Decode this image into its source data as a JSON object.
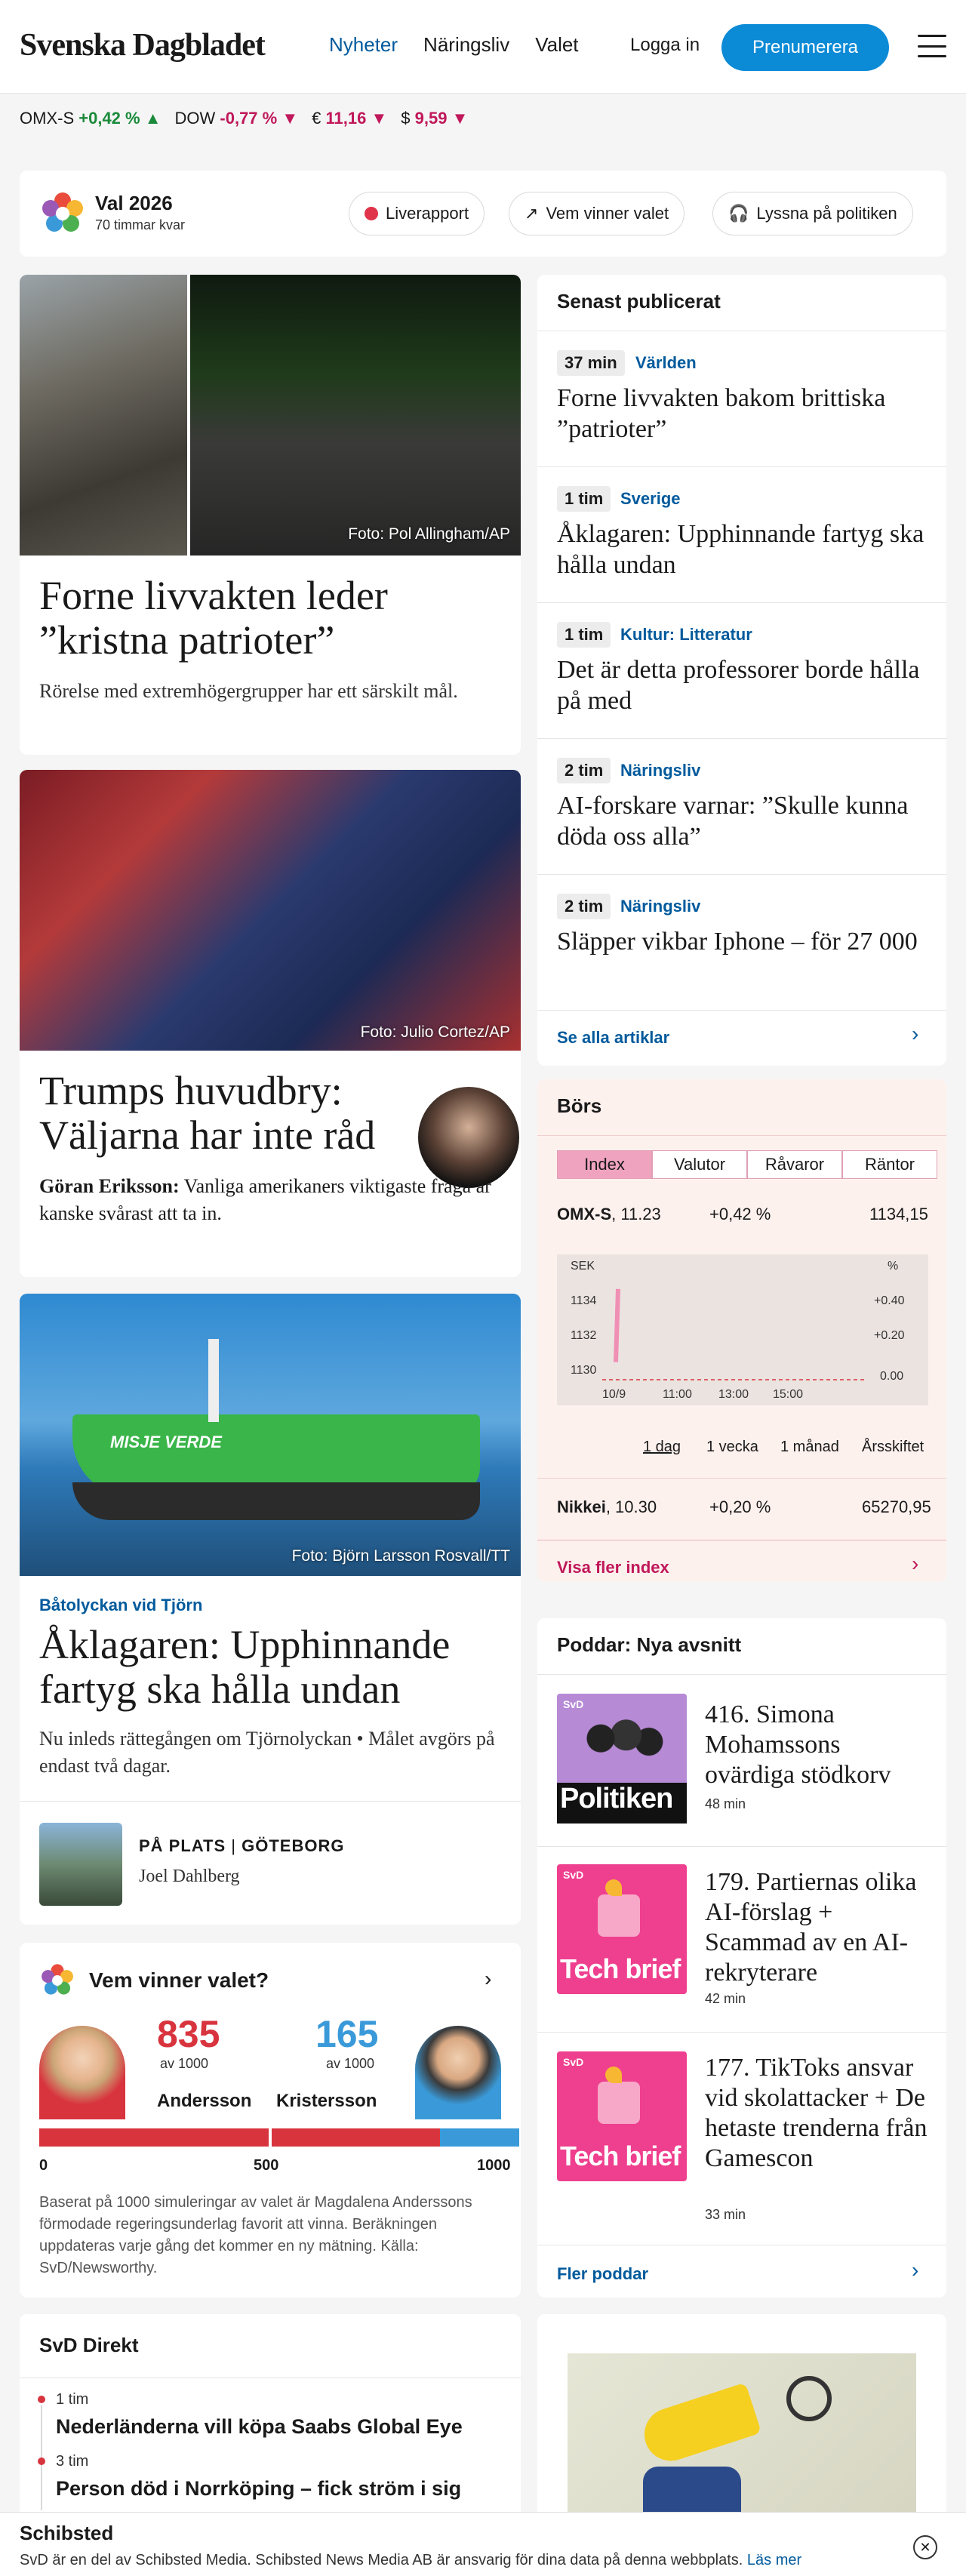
{
  "header": {
    "logo": "Svenska Dagbladet",
    "nav": [
      "Nyheter",
      "Näringsliv",
      "Valet"
    ],
    "login": "Logga in",
    "subscribe": "Prenumerera"
  },
  "ticker": [
    {
      "name": "OMX-S",
      "value": "+0,42 %",
      "arrow": "▲"
    },
    {
      "name": "DOW",
      "value": "-0,77 %",
      "arrow": "▼"
    },
    {
      "name": "€",
      "value": "11,16",
      "arrow": "▼"
    },
    {
      "name": "$",
      "value": "9,59",
      "arrow": "▼"
    }
  ],
  "valbar": {
    "title": "Val 2026",
    "subtitle": "70 timmar kvar",
    "pills": [
      "Liverapport",
      "Vem vinner valet",
      "Lyssna på politiken"
    ]
  },
  "article1": {
    "caption": "Foto: Pol Allingham/AP",
    "title": "Forne livvakten leder ”kristna patrioter”",
    "lead": "Rörelse med extremhögergrupper har ett särskilt mål."
  },
  "article2": {
    "caption": "Foto: Julio Cortez/AP",
    "title": "Trumps huvudbry: Väljarna har inte råd",
    "author": "Göran Eriksson:",
    "lead": " Vanliga amerikaners viktigaste fråga är kanske svårast att ta in."
  },
  "article3": {
    "caption": "Foto: Björn Larsson Rosvall/TT",
    "ship_text": "MISJE VERDE",
    "kicker": "Båtolyckan vid Tjörn",
    "title": "Åklagaren: Upphinnande fartyg ska hålla undan",
    "lead": "Nu inleds rättegången om Tjörnolyckan • Målet avgörs på endast två dagar.",
    "place_a": "PÅ PLATS",
    "place_sep": "|",
    "place_b": "GÖTEBORG",
    "reporter": "Joel Dahlberg"
  },
  "vvv": {
    "title": "Vem vinner valet?",
    "left_num": "835",
    "left_of": "av 1000",
    "left_name": "Andersson",
    "right_num": "165",
    "right_of": "av 1000",
    "right_name": "Kristersson",
    "ticks": [
      "0",
      "500",
      "1000"
    ],
    "left_share": 0.835,
    "note": "Baserat på 1000 simuleringar av valet är Magdalena Anderssons förmodade regeringsunderlag favorit att vinna. Beräkningen uppdateras varje gång det kommer en ny mätning. Källa: SvD/Newsworthy.",
    "colors": {
      "red": "#d8343e",
      "blue": "#3a9ad9"
    }
  },
  "direkt": {
    "title": "SvD Direkt",
    "items": [
      {
        "time": "1 tim",
        "headline": "Nederländerna vill köpa Saabs Global Eye"
      },
      {
        "time": "3 tim",
        "headline": "Person död i Norrköping – fick ström i sig"
      }
    ]
  },
  "senast": {
    "title": "Senast publicerat",
    "items": [
      {
        "time": "37 min",
        "category": "Världen",
        "headline": "Forne livvakten bakom brittiska ”patrioter”"
      },
      {
        "time": "1 tim",
        "category": "Sverige",
        "headline": "Åklagaren: Upphinnande fartyg ska hålla undan"
      },
      {
        "time": "1 tim",
        "category": "Kultur: Litteratur",
        "headline": "Det är detta professorer borde hålla på med"
      },
      {
        "time": "2 tim",
        "category": "Näringsliv",
        "headline": "AI-forskare varnar: ”Skulle kunna döda oss alla”"
      },
      {
        "time": "2 tim",
        "category": "Näringsliv",
        "headline": "Släpper vikbar Iphone – för 27 000"
      }
    ],
    "more": "Se alla artiklar"
  },
  "bors": {
    "title": "Börs",
    "tabs": [
      "Index",
      "Valutor",
      "Råvaror",
      "Räntor"
    ],
    "omx": {
      "name": "OMX-S",
      "time": ", 11.23",
      "change": "+0,42 %",
      "value": "1134,15"
    },
    "chart": {
      "unit_left": "SEK",
      "unit_right": "%",
      "y_left": [
        "1134",
        "1132",
        "1130"
      ],
      "y_right": [
        "+0.40",
        "+0.20",
        "0.00"
      ],
      "x": [
        "10/9",
        "11:00",
        "13:00",
        "15:00"
      ]
    },
    "ranges": [
      "1 dag",
      "1 vecka",
      "1 månad",
      "Årsskiftet"
    ],
    "nikkei": {
      "name": "Nikkei",
      "time": ", 10.30",
      "change": "+0,20 %",
      "value": "65270,95"
    },
    "more": "Visa fler index"
  },
  "chart_data": {
    "type": "line",
    "title": "",
    "xlabel": "",
    "ylabel": "SEK",
    "x": [
      "10/9",
      "11:00",
      "13:00",
      "15:00"
    ],
    "series": [
      {
        "values": [
          1130.0,
          1134.15,
          null,
          null
        ]
      }
    ],
    "ylim": [
      1129,
      1135
    ],
    "y2lim": [
      0.0,
      0.5
    ]
  },
  "poddar": {
    "title": "Poddar: Nya avsnitt",
    "items": [
      {
        "show": "Politiken",
        "brand": "SvD",
        "title": "416. Simona Mohamssons ovärdiga stödkorv",
        "minutes": "48 min"
      },
      {
        "show": "Tech brief",
        "brand": "SvD",
        "title": "179. Partiernas olika AI-förslag + Scammad av en AI-rekryterare",
        "minutes": "42 min"
      },
      {
        "show": "Tech brief",
        "brand": "SvD",
        "title": "177. TikToks ansvar vid skolattacker + De hetaste trenderna från Gamescon",
        "minutes": "33 min"
      }
    ],
    "more": "Fler poddar"
  },
  "footer": {
    "brand": "Schibsted",
    "text": "SvD är en del av Schibsted Media. Schibsted News Media AB är ansvarig för dina data på denna webbplats.",
    "link": "Läs mer"
  }
}
